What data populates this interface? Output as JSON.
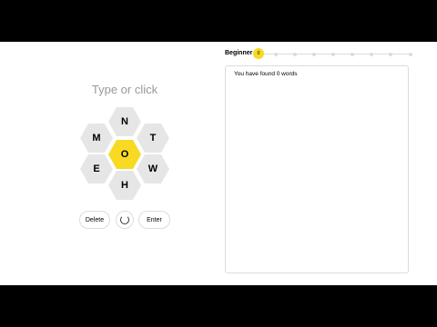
{
  "input": {
    "placeholder": "Type or click"
  },
  "hive": {
    "letters": {
      "top": "N",
      "top_left": "M",
      "top_right": "T",
      "center": "O",
      "bottom_left": "E",
      "bottom_right": "W",
      "bottom": "H"
    },
    "center_color": "#f7da21",
    "outer_color": "#e6e6e6"
  },
  "controls": {
    "delete_label": "Delete",
    "shuffle_icon": "shuffle-icon",
    "enter_label": "Enter"
  },
  "progress": {
    "rank": "Beginner",
    "score": "0",
    "marker_color": "#f7da21"
  },
  "wordlist": {
    "found_text": "You have found 0 words"
  }
}
